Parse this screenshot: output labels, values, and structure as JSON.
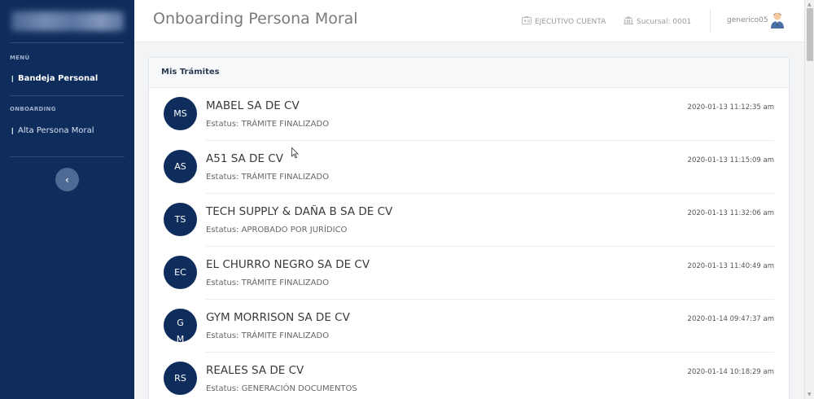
{
  "sidebar": {
    "menu_section": "MENÚ",
    "item_bandeja": "Bandeja Personal",
    "onboarding_section": "ONBOARDING",
    "item_alta": "Alta Persona Moral",
    "collapse_glyph": "‹"
  },
  "header": {
    "title": "Onboarding Persona Moral",
    "ejecutivo": "EJECUTIVO CUENTA",
    "sucursal": "Sucursal: 0001",
    "username": "generico05"
  },
  "card": {
    "title": "Mis Trámites",
    "status_prefix": "Estatus: ",
    "rows": [
      {
        "initials": "MS",
        "name": "MABEL SA DE CV",
        "status": "Estatus: TRÁMITE FINALIZADO",
        "timestamp": "2020-01-13 11:12:35 am"
      },
      {
        "initials": "AS",
        "name": "A51 SA DE CV",
        "status": "Estatus: TRÁMITE FINALIZADO",
        "timestamp": "2020-01-13 11:15:09 am"
      },
      {
        "initials": "TS",
        "name": "TECH SUPPLY & DAÑA B SA DE CV",
        "status": "Estatus: APROBADO POR JURÍDICO",
        "timestamp": "2020-01-13 11:32:06 am"
      },
      {
        "initials": "EC",
        "name": "EL CHURRO NEGRO SA DE CV",
        "status": "Estatus: TRÁMITE FINALIZADO",
        "timestamp": "2020-01-13 11:40:49 am"
      },
      {
        "initials": "GM",
        "name": "GYM MORRISON SA DE CV",
        "status": "Estatus: TRÁMITE FINALIZADO",
        "timestamp": "2020-01-14 09:47:37 am"
      },
      {
        "initials": "RS",
        "name": "REALES SA DE CV",
        "status": "Estatus: GENERACIÓN DOCUMENTOS",
        "timestamp": "2020-01-14 10:18:29 am"
      }
    ]
  },
  "colors": {
    "sidebar_bg": "#0f2d5c",
    "badge_bg": "#0f2d5c",
    "page_bg": "#f3f4f6"
  },
  "icons": {
    "ejecutivo": "id-card-icon",
    "sucursal": "bank-icon",
    "user": "user-avatar-icon",
    "collapse": "chevron-left-icon",
    "menu_pin": "pin-icon"
  }
}
